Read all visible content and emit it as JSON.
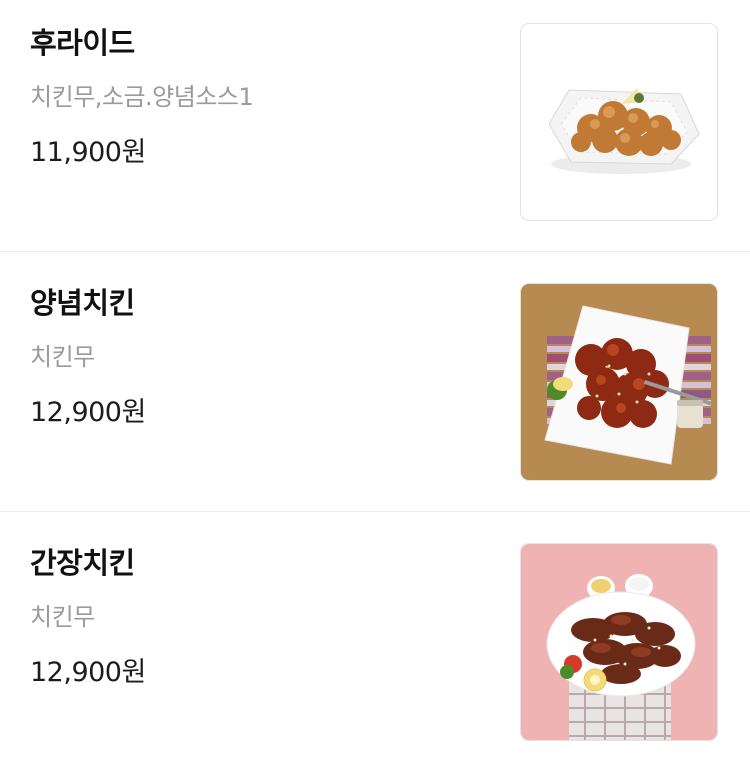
{
  "menu": {
    "items": [
      {
        "name": "후라이드",
        "description": "치킨무,소금.양념소스1",
        "price": "11,900원",
        "image_icon": "fried-chicken-photo"
      },
      {
        "name": "양념치킨",
        "description": "치킨무",
        "price": "12,900원",
        "image_icon": "yangnyeom-chicken-photo"
      },
      {
        "name": "간장치킨",
        "description": "치킨무",
        "price": "12,900원",
        "image_icon": "soy-chicken-photo"
      }
    ]
  },
  "colors": {
    "name_text": "#111111",
    "description_text": "#9a9a9a",
    "price_text": "#1c1c1c",
    "divider": "#ececec"
  }
}
